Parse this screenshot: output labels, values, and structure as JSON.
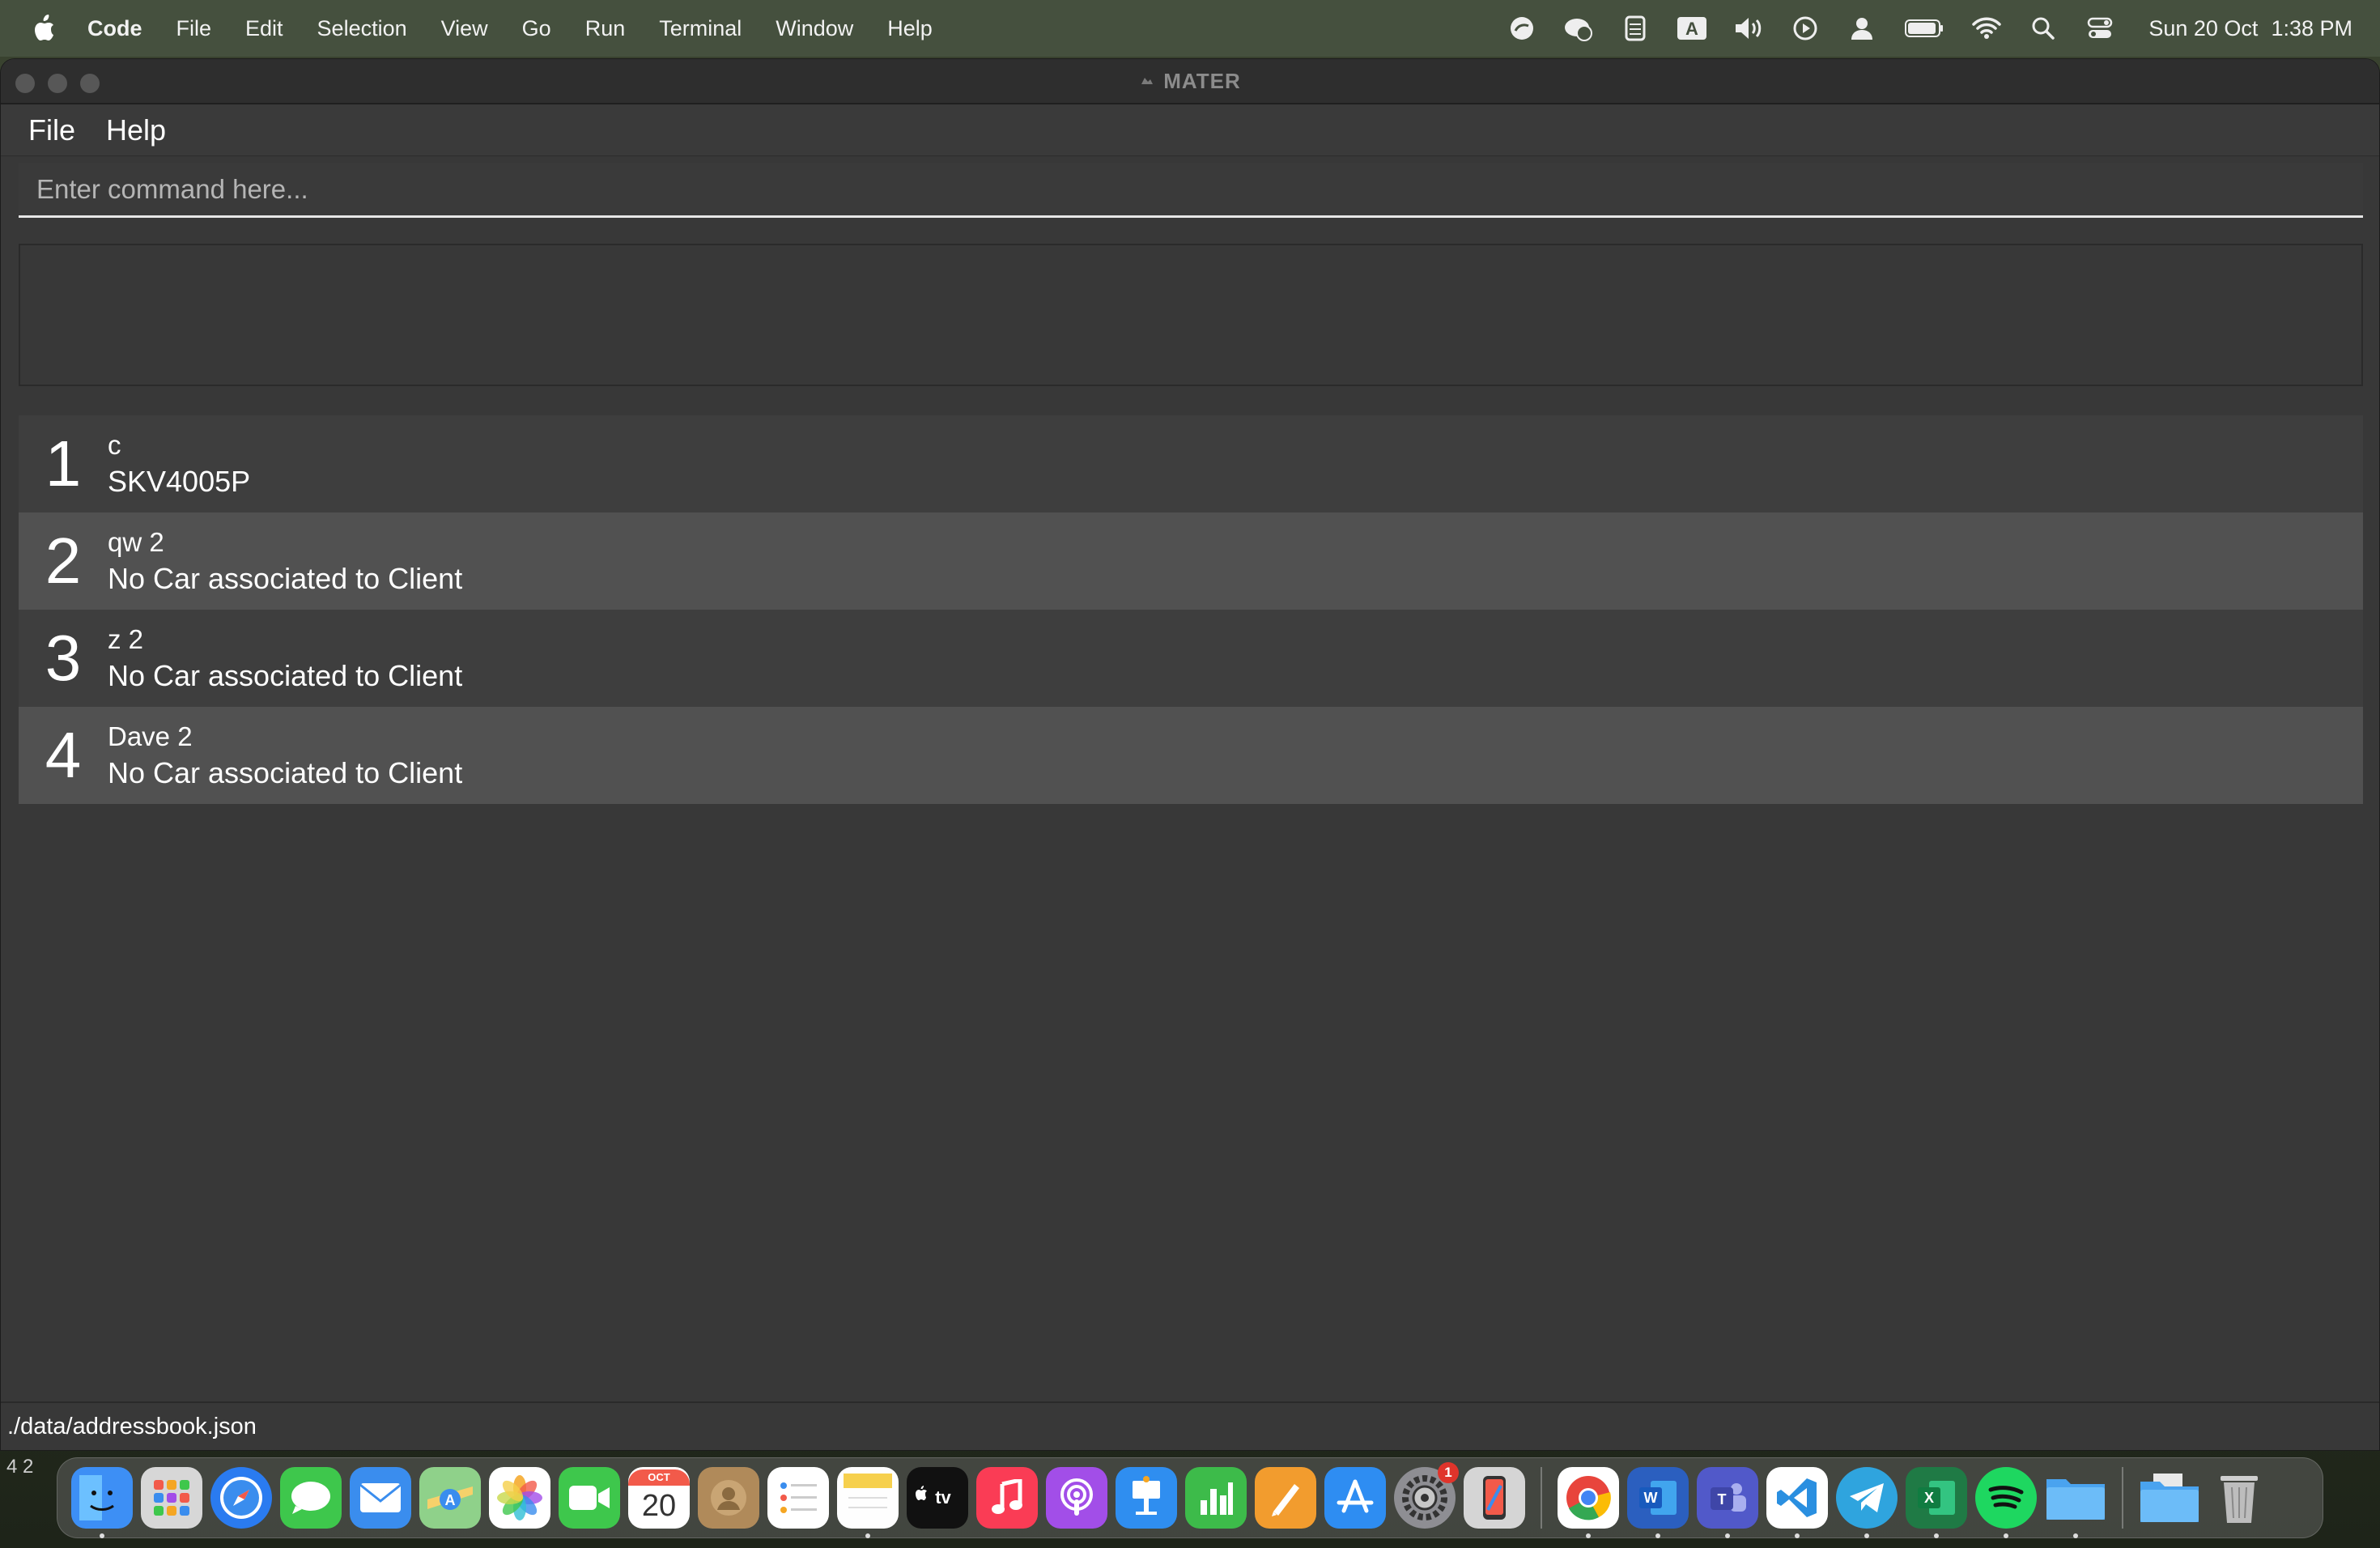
{
  "menubar": {
    "app_name": "Code",
    "items": [
      "File",
      "Edit",
      "Selection",
      "View",
      "Go",
      "Run",
      "Terminal",
      "Window",
      "Help"
    ],
    "status_icons": [
      "sync-icon",
      "cloud-icon",
      "chip-icon",
      "keyboard-a-icon",
      "volume-icon",
      "play-icon",
      "user-icon",
      "battery-icon",
      "wifi-icon",
      "search-icon",
      "control-center-icon"
    ],
    "date": "Sun 20 Oct",
    "time": "1:38 PM"
  },
  "window": {
    "title": "MATER"
  },
  "app_menu": {
    "file": "File",
    "help": "Help"
  },
  "command": {
    "placeholder": "Enter command here..."
  },
  "clients": [
    {
      "index": "1",
      "name": "c",
      "car": "SKV4005P"
    },
    {
      "index": "2",
      "name": "qw 2",
      "car": "No Car associated to Client"
    },
    {
      "index": "3",
      "name": "z 2",
      "car": "No Car associated to Client"
    },
    {
      "index": "4",
      "name": "Dave 2",
      "car": "No Car associated to Client"
    }
  ],
  "status_bar": {
    "path": "./data/addressbook.json"
  },
  "dock": {
    "left_digits": "4   2",
    "calendar_month": "OCT",
    "calendar_day": "20",
    "settings_badge": "1",
    "colors": {
      "finder": "#3d8ff5",
      "safari": "#2a7bf0",
      "messages": "#3ec74c",
      "mail": "#3a8dee",
      "facetime": "#3ec74c",
      "music": "#fa3c55",
      "podcasts": "#a24ee8",
      "keynote": "#2f8ef0",
      "numbers": "#3dbb4a",
      "pages": "#f29c2e",
      "appstore": "#2e8df2",
      "word": "#2b5fbf",
      "teams": "#5159c9",
      "vscode": "#2a8fe0",
      "telegram": "#2fa4de",
      "excel": "#1f7a45",
      "spotify": "#1ed760",
      "folder": "#5ab0f5"
    }
  }
}
